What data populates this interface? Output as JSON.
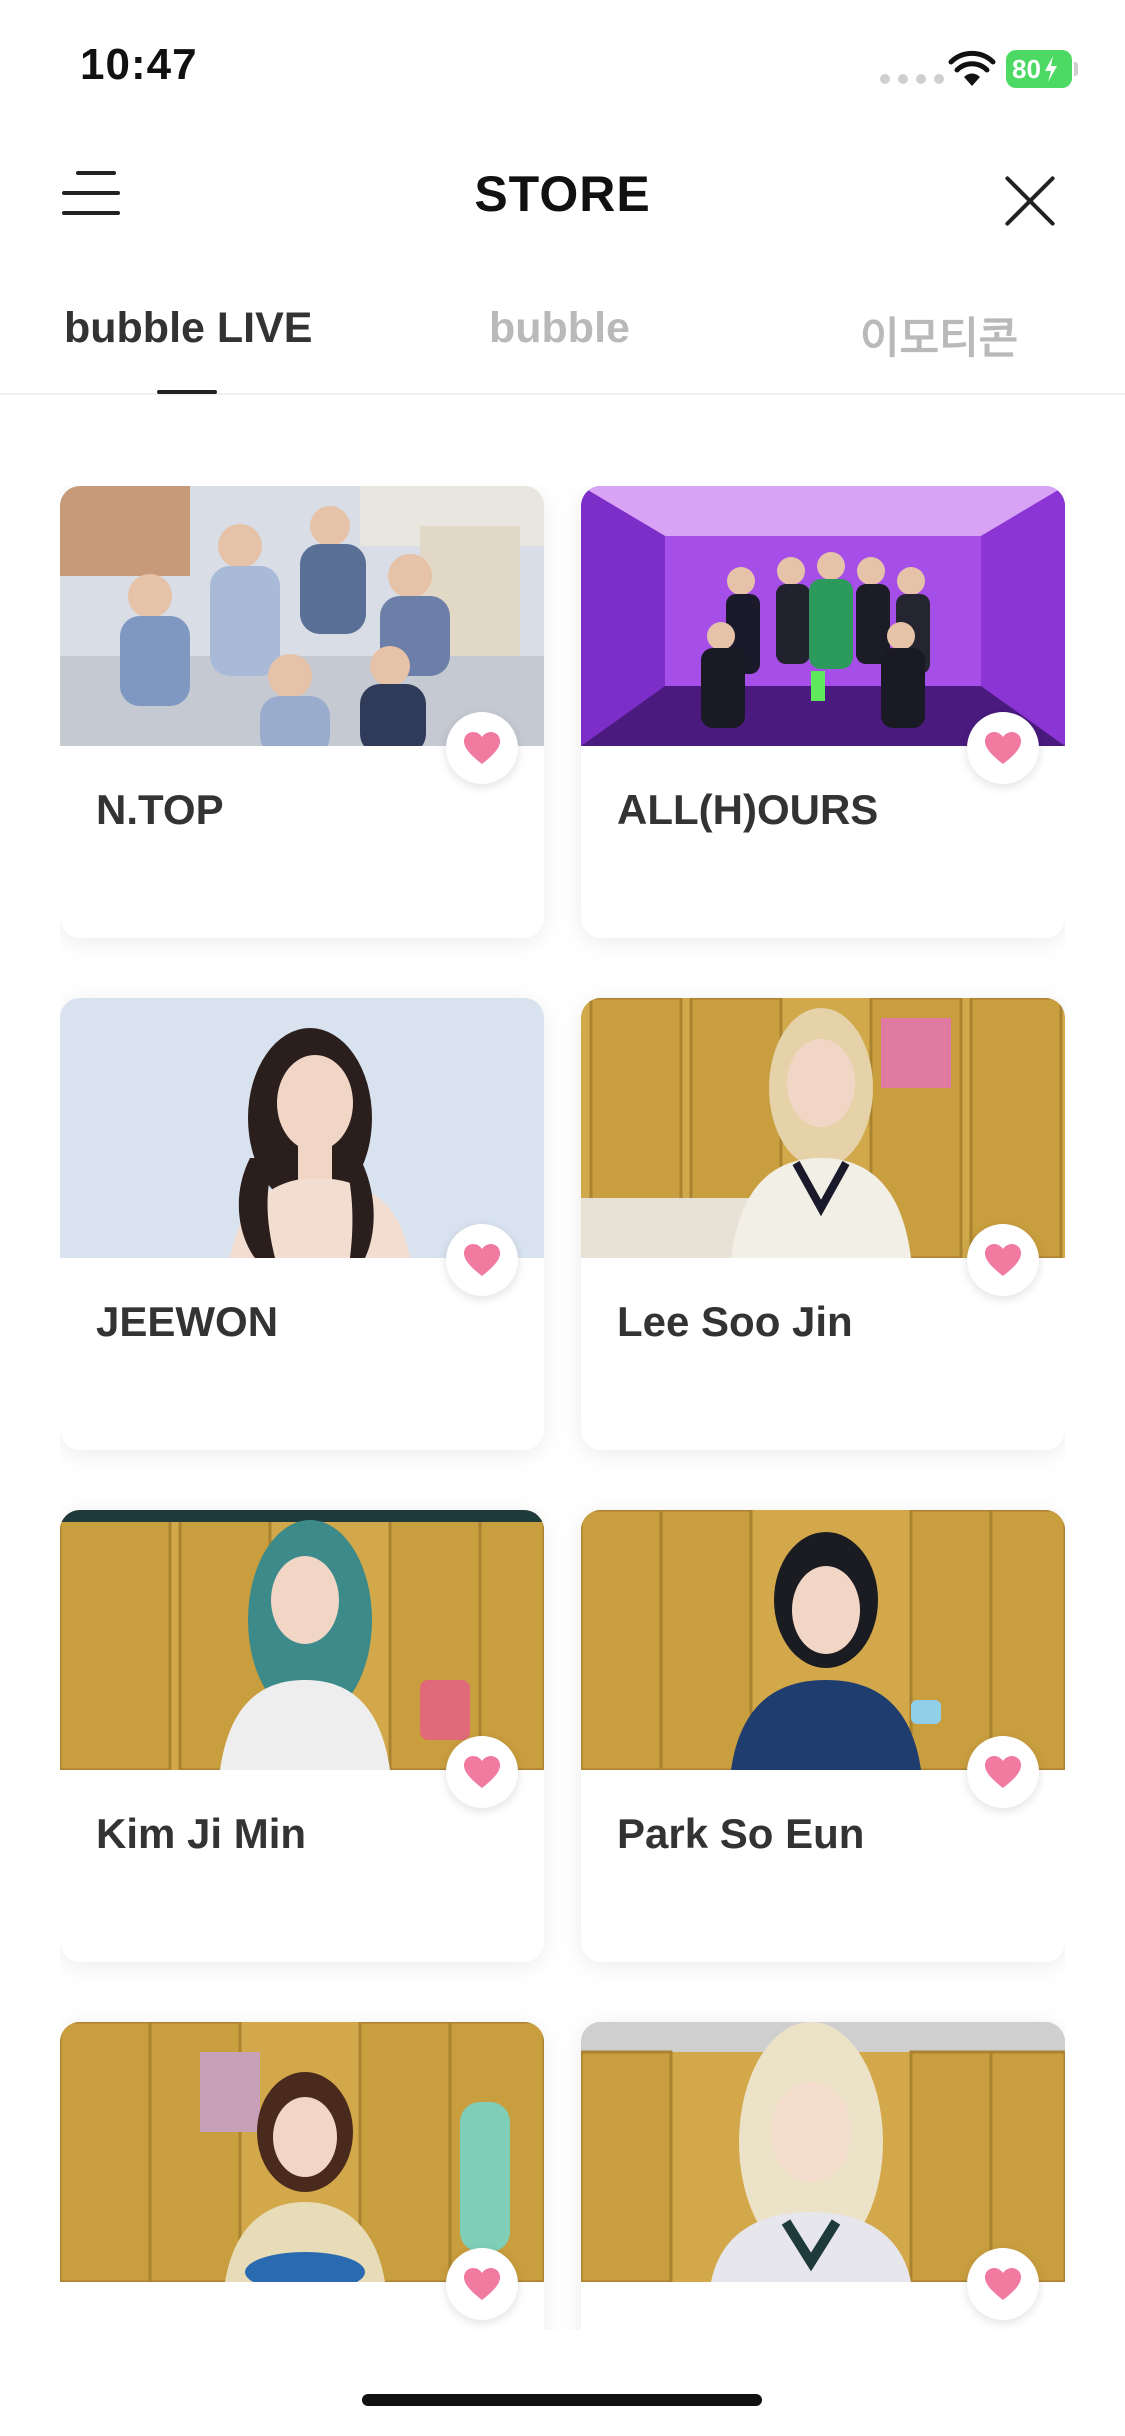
{
  "status_bar": {
    "time": "10:47",
    "battery": "80"
  },
  "header": {
    "title": "STORE"
  },
  "tabs": [
    {
      "label": "bubble LIVE",
      "active": true
    },
    {
      "label": "bubble",
      "active": false
    },
    {
      "label": "이모티콘",
      "active": false
    }
  ],
  "artists": [
    {
      "name": "N.TOP",
      "favorite_icon": "heart-icon"
    },
    {
      "name": "ALL(H)OURS",
      "favorite_icon": "heart-icon"
    },
    {
      "name": "JEEWON",
      "favorite_icon": "heart-icon"
    },
    {
      "name": "Lee Soo Jin",
      "favorite_icon": "heart-icon"
    },
    {
      "name": "Kim Ji Min",
      "favorite_icon": "heart-icon"
    },
    {
      "name": "Park So Eun",
      "favorite_icon": "heart-icon"
    },
    {
      "name": "",
      "favorite_icon": "heart-icon"
    },
    {
      "name": "",
      "favorite_icon": "heart-icon"
    }
  ],
  "colors": {
    "heart": "#f07aa0",
    "battery": "#4cd964",
    "accent_text": "#333333",
    "inactive_tab": "#b9b9b9"
  }
}
